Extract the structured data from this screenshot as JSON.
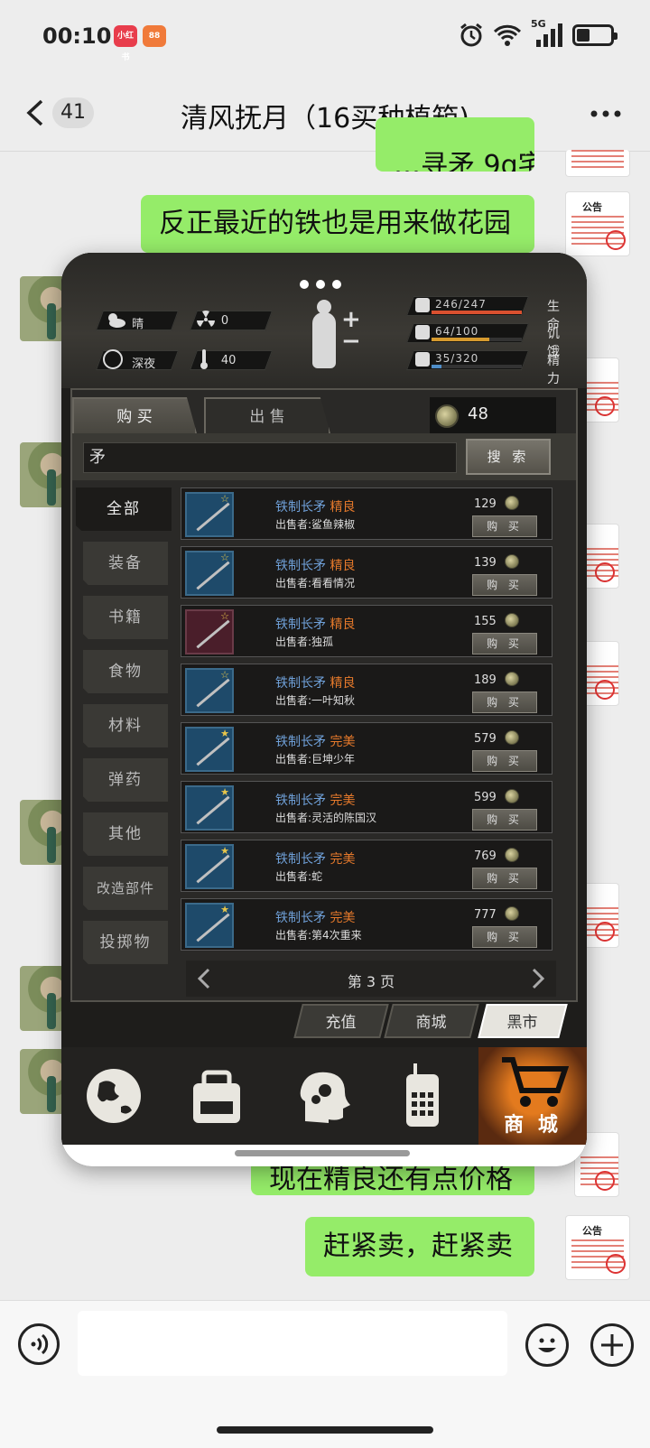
{
  "status_bar": {
    "time": "00:10",
    "badge1": "小红书",
    "badge2": "88",
    "network": "5G"
  },
  "chat": {
    "unread_count": "41",
    "title": "清风抚月（16买种植箱)",
    "messages": [
      {
        "text": "…寻矛 9g宅",
        "partial": true
      },
      {
        "text": "反正最近的铁也是用来做花园"
      },
      {
        "text": "现在精良还有点价格"
      },
      {
        "text": "赶紧卖，赶紧卖"
      }
    ],
    "avatar_text": "公告"
  },
  "game": {
    "hud": {
      "weather": "晴",
      "radiation": "0",
      "time_of_day": "深夜",
      "temperature": "40",
      "stats": [
        {
          "value": "246/247",
          "label": "生命",
          "fraction": 0.996,
          "color": "#d9502f"
        },
        {
          "value": "64/100",
          "label": "饥饿",
          "fraction": 0.64,
          "color": "#d59a2e"
        },
        {
          "value": "35/320",
          "label": "精力",
          "fraction": 0.11,
          "color": "#4f8ec9"
        }
      ]
    },
    "shop": {
      "tab_buy": "购 买",
      "tab_sell": "出 售",
      "coins": "48",
      "search_value": "矛",
      "search_button": "搜 索",
      "categories": [
        "全部",
        "装备",
        "书籍",
        "食物",
        "材料",
        "弹药",
        "其他",
        "改造部件",
        "投掷物"
      ],
      "items": [
        {
          "name": "铁制长矛",
          "quality": "精良",
          "seller": "出售者:鲨鱼辣椒",
          "price": "129",
          "buy": "购 买"
        },
        {
          "name": "铁制长矛",
          "quality": "精良",
          "seller": "出售者:看看情况",
          "price": "139",
          "buy": "购 买"
        },
        {
          "name": "铁制长矛",
          "quality": "精良",
          "seller": "出售者:独孤",
          "price": "155",
          "buy": "购 买"
        },
        {
          "name": "铁制长矛",
          "quality": "精良",
          "seller": "出售者:一叶知秋",
          "price": "189",
          "buy": "购 买"
        },
        {
          "name": "铁制长矛",
          "quality": "完美",
          "seller": "出售者:巨坤少年",
          "price": "579",
          "buy": "购 买"
        },
        {
          "name": "铁制长矛",
          "quality": "完美",
          "seller": "出售者:灵活的陈国汉",
          "price": "599",
          "buy": "购 买"
        },
        {
          "name": "铁制长矛",
          "quality": "完美",
          "seller": "出售者:蛇",
          "price": "769",
          "buy": "购 买"
        },
        {
          "name": "铁制长矛",
          "quality": "完美",
          "seller": "出售者:第4次重来",
          "price": "777",
          "buy": "购 买"
        }
      ],
      "page": "第 3 页",
      "store_tabs": [
        "充值",
        "商城",
        "黑市"
      ],
      "nav_shop_label": "商 城"
    }
  }
}
